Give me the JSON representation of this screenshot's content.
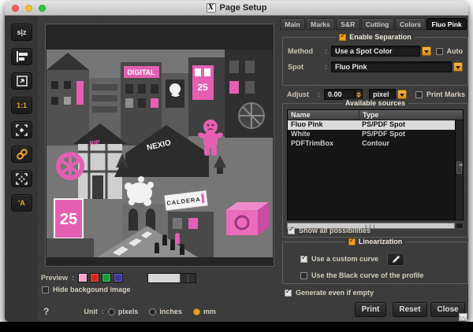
{
  "ui": {
    "colon": ":",
    "help": "?"
  },
  "window": {
    "title": "Page Setup",
    "x11_glyph": "X"
  },
  "sidebar": {
    "tools": [
      {
        "name": "mirror",
        "glyph": "s|z"
      },
      {
        "name": "align-left",
        "glyph": ""
      },
      {
        "name": "export",
        "glyph": ""
      },
      {
        "name": "one-to-one",
        "glyph": "1:1"
      },
      {
        "name": "crop-marks",
        "glyph": ""
      },
      {
        "name": "link",
        "glyph": ""
      },
      {
        "name": "expand",
        "glyph": ""
      },
      {
        "name": "annotate",
        "glyph": "'A"
      }
    ]
  },
  "tabs": [
    {
      "label": "Main",
      "active": false
    },
    {
      "label": "Marks",
      "active": false
    },
    {
      "label": "S&R",
      "active": false
    },
    {
      "label": "Cutting",
      "active": false
    },
    {
      "label": "Colors",
      "active": false
    },
    {
      "label": "Fluo Pink",
      "active": true
    }
  ],
  "separation": {
    "group_label": "Enable Separation",
    "enabled": true,
    "method_label": "Method",
    "method_value": "Use a Spot Color",
    "auto_label": "Auto",
    "auto_checked": false,
    "spot_label": "Spot",
    "spot_value": "Fluo Pink",
    "adjust_label": "Adjust",
    "adjust_value": "0.00",
    "adjust_unit": "pixel",
    "print_marks_label": "Print Marks",
    "print_marks_checked": false
  },
  "sources": {
    "group_label": "Available sources",
    "columns": [
      "Name",
      "Type"
    ],
    "rows": [
      {
        "name": "Fluo Pink",
        "type": "PS/PDF Spot",
        "selected": true
      },
      {
        "name": "White",
        "type": "PS/PDF Spot",
        "selected": false
      },
      {
        "name": "PDFTrimBox",
        "type": "Contour",
        "selected": false
      }
    ],
    "show_all_label": "Show all possibilities",
    "show_all_checked": true
  },
  "linearization": {
    "group_label": "Linearization",
    "enabled": true,
    "custom_curve_label": "Use a custom curve",
    "custom_curve_checked": true,
    "black_curve_label": "Use the Black curve of the profile",
    "black_curve_checked": false
  },
  "footer": {
    "generate_label": "Generate even if empty",
    "generate_checked": true,
    "buttons": {
      "print": "Print",
      "reset": "Reset",
      "close": "Close"
    }
  },
  "preview": {
    "label": "Preview",
    "swatches": [
      "#f2a3ce",
      "#d6251d",
      "#169e38",
      "#3a31a5"
    ],
    "hide_bg_label": "Hide backgound image",
    "hide_bg_checked": false
  },
  "unit": {
    "label": "Unit",
    "options": [
      {
        "label": "pixels",
        "selected": false
      },
      {
        "label": "inches",
        "selected": false
      },
      {
        "label": "mm",
        "selected": true
      }
    ]
  },
  "artwork": {
    "texts": {
      "digital": "DIGITAL",
      "nexio": "NEXIO",
      "poster25": "25",
      "caldera": "CALDERA",
      "rip": "RIP"
    }
  },
  "colors": {
    "accent_orange": "#f09c1e",
    "magenta": "#e45fb2",
    "selection": "#dadada",
    "panel_bg": "#3a3a3a"
  }
}
